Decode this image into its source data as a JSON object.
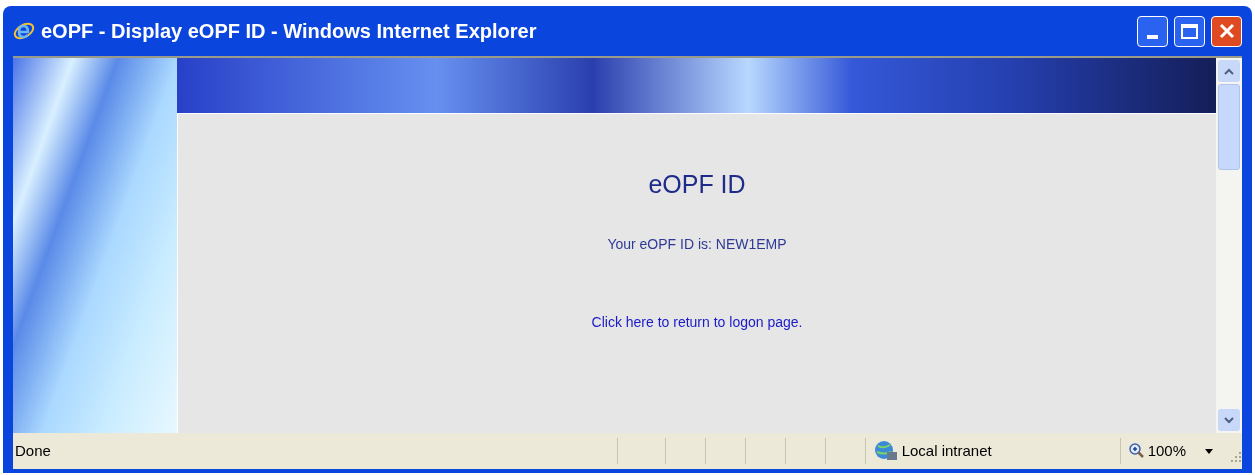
{
  "window": {
    "title": "eOPF - Display eOPF ID - Windows Internet Explorer"
  },
  "page": {
    "heading": "eOPF ID",
    "message": "Your eOPF ID is: NEW1EMP",
    "link": "Click here to return to logon page."
  },
  "status_bar": {
    "status": "Done",
    "zone": "Local intranet",
    "zoom": "100%"
  }
}
